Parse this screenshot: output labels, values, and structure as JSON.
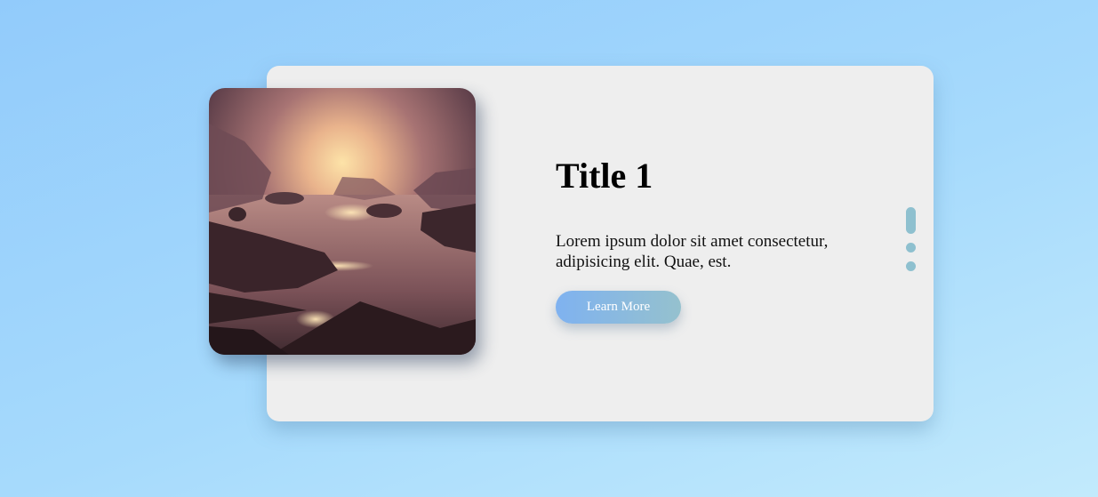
{
  "slide": {
    "title": "Title 1",
    "description": "Lorem ipsum dolor sit amet consectetur, adipisicing elit. Quae, est.",
    "button_label": "Learn More",
    "image_icon": "sunset-coast-photo"
  },
  "pagination": {
    "count": 3,
    "active_index": 0
  },
  "colors": {
    "card": "#eeeeee",
    "button_gradient_start": "#7fb2f0",
    "button_gradient_end": "#95c1ce",
    "pagination_dot": "#8ec0cf"
  }
}
